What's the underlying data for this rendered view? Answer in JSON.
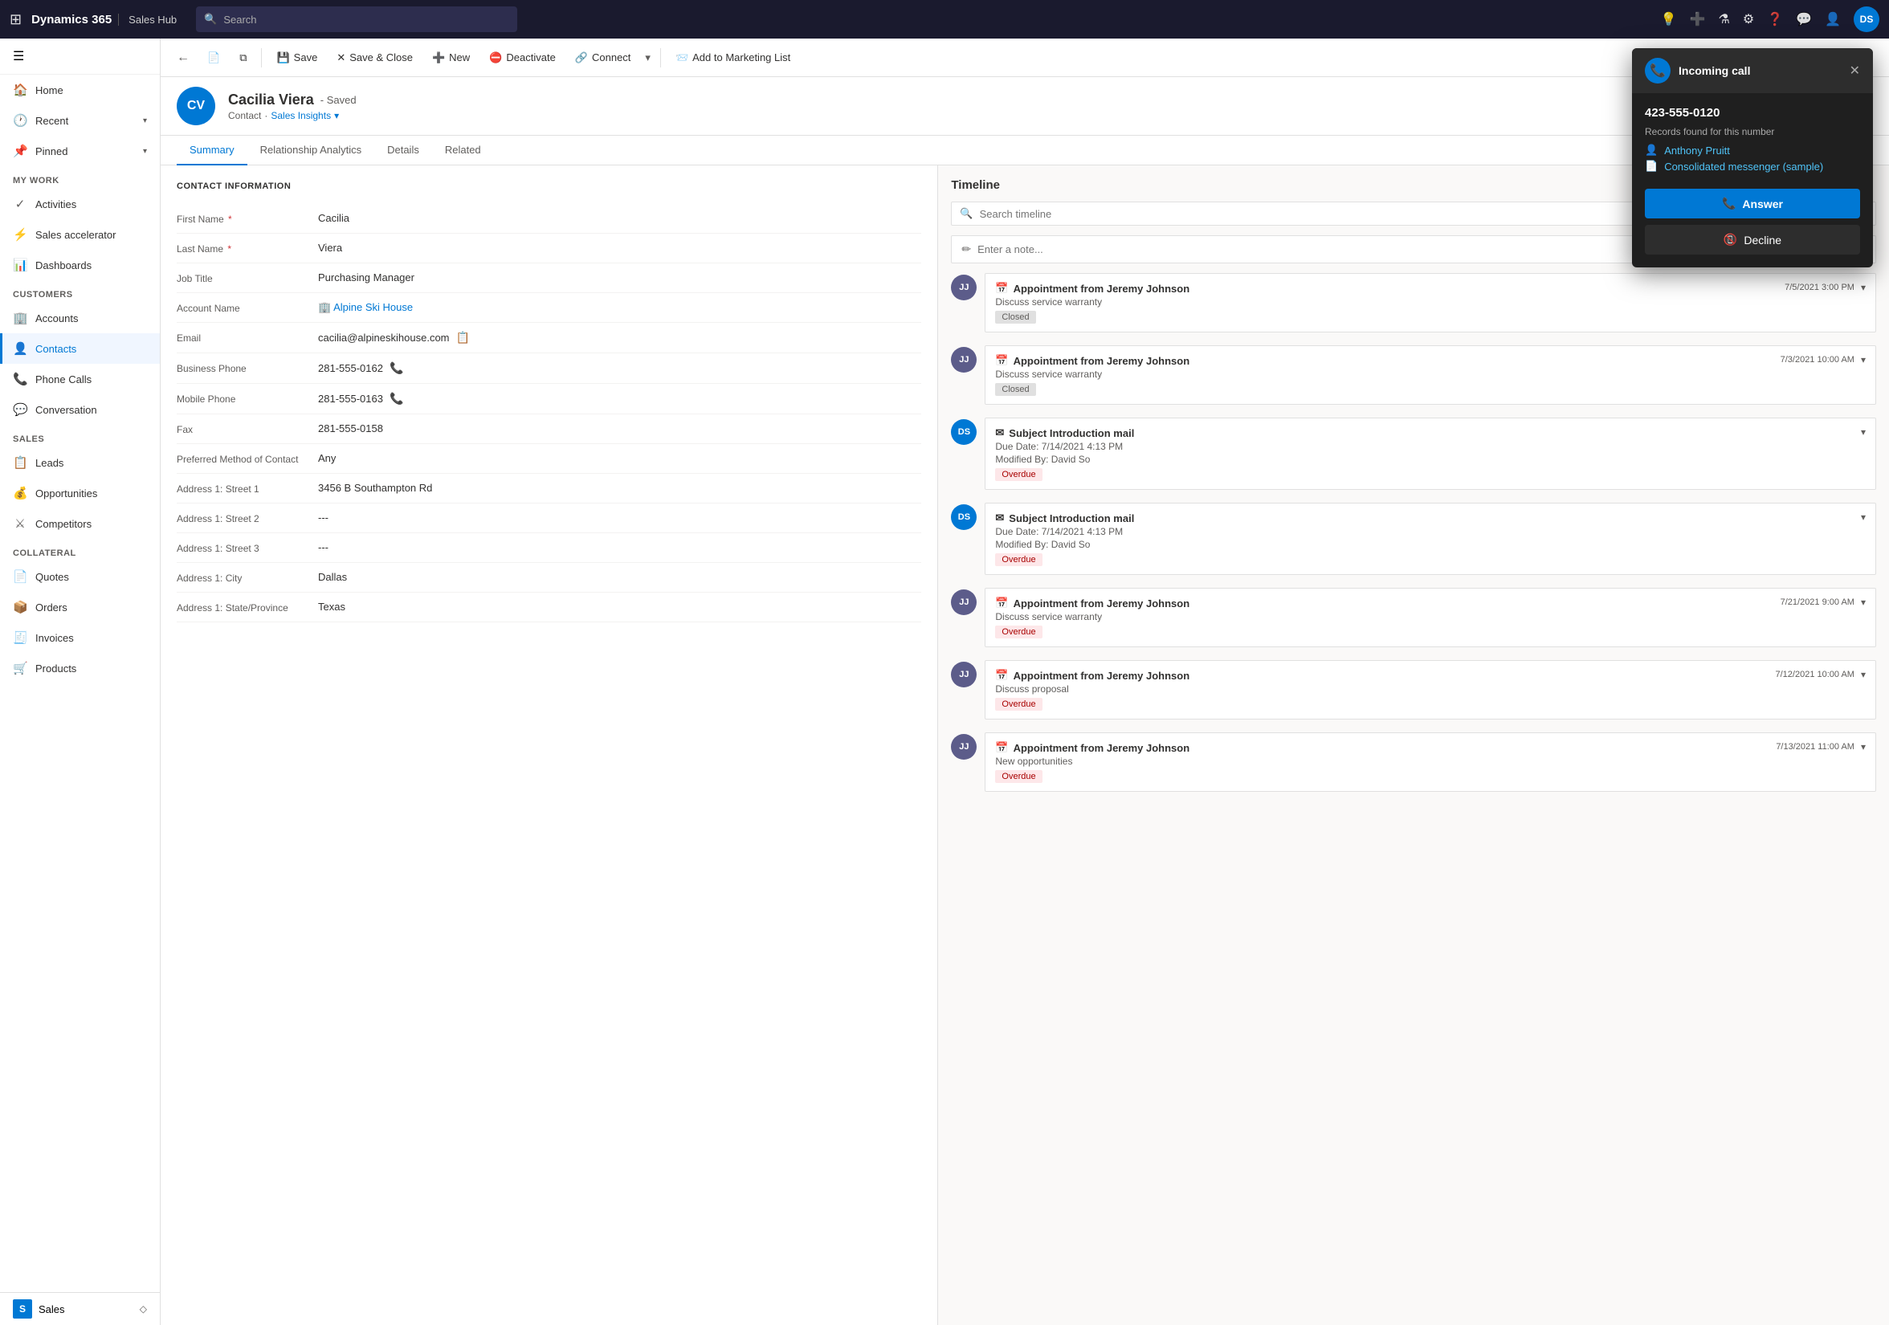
{
  "app": {
    "brand": "Dynamics 365",
    "module": "Sales Hub",
    "search_placeholder": "Search",
    "user_initials": "DS"
  },
  "toolbar": {
    "back_label": "←",
    "save_label": "Save",
    "save_close_label": "Save & Close",
    "new_label": "New",
    "deactivate_label": "Deactivate",
    "connect_label": "Connect",
    "add_marketing_label": "Add to Marketing List"
  },
  "sidebar": {
    "sections": [
      {
        "label": "",
        "items": [
          {
            "id": "home",
            "label": "Home",
            "icon": "🏠",
            "active": false
          },
          {
            "id": "recent",
            "label": "Recent",
            "icon": "🕐",
            "active": false,
            "hasChevron": true
          },
          {
            "id": "pinned",
            "label": "Pinned",
            "icon": "📌",
            "active": false,
            "hasChevron": true
          }
        ]
      },
      {
        "label": "My Work",
        "items": [
          {
            "id": "activities",
            "label": "Activities",
            "icon": "✓",
            "active": false
          },
          {
            "id": "sales-accelerator",
            "label": "Sales accelerator",
            "icon": "⚡",
            "active": false
          },
          {
            "id": "dashboards",
            "label": "Dashboards",
            "icon": "📊",
            "active": false
          }
        ]
      },
      {
        "label": "Customers",
        "items": [
          {
            "id": "accounts",
            "label": "Accounts",
            "icon": "🏢",
            "active": false
          },
          {
            "id": "contacts",
            "label": "Contacts",
            "icon": "👤",
            "active": true
          },
          {
            "id": "phone-calls",
            "label": "Phone Calls",
            "icon": "📞",
            "active": false
          },
          {
            "id": "conversation",
            "label": "Conversation",
            "icon": "💬",
            "active": false
          }
        ]
      },
      {
        "label": "Sales",
        "items": [
          {
            "id": "leads",
            "label": "Leads",
            "icon": "📋",
            "active": false
          },
          {
            "id": "opportunities",
            "label": "Opportunities",
            "icon": "💰",
            "active": false
          },
          {
            "id": "competitors",
            "label": "Competitors",
            "icon": "⚔",
            "active": false
          }
        ]
      },
      {
        "label": "Collateral",
        "items": [
          {
            "id": "quotes",
            "label": "Quotes",
            "icon": "📄",
            "active": false
          },
          {
            "id": "orders",
            "label": "Orders",
            "icon": "📦",
            "active": false
          },
          {
            "id": "invoices",
            "label": "Invoices",
            "icon": "🧾",
            "active": false
          },
          {
            "id": "products",
            "label": "Products",
            "icon": "🛒",
            "active": false
          }
        ]
      },
      {
        "label": "",
        "items": [
          {
            "id": "sales-bottom",
            "label": "Sales",
            "icon": "S",
            "active": false,
            "isBottom": true
          }
        ]
      }
    ]
  },
  "record": {
    "initials": "CV",
    "name": "Cacilia Viera",
    "saved_status": "- Saved",
    "type": "Contact",
    "enriched_label": "Sales Insights",
    "tabs": [
      "Summary",
      "Relationship Analytics",
      "Details",
      "Related"
    ],
    "active_tab": "Summary"
  },
  "contact_info": {
    "section_title": "CONTACT INFORMATION",
    "fields": [
      {
        "label": "First Name",
        "value": "Cacilia",
        "required": true
      },
      {
        "label": "Last Name",
        "value": "Viera",
        "required": true
      },
      {
        "label": "Job Title",
        "value": "Purchasing Manager",
        "required": false
      },
      {
        "label": "Account Name",
        "value": "Alpine Ski House",
        "is_link": true,
        "required": false
      },
      {
        "label": "Email",
        "value": "cacilia@alpineskihouse.com",
        "has_icon": true,
        "required": false
      },
      {
        "label": "Business Phone",
        "value": "281-555-0162",
        "has_phone_icon": true,
        "required": false
      },
      {
        "label": "Mobile Phone",
        "value": "281-555-0163",
        "has_phone_icon": true,
        "required": false
      },
      {
        "label": "Fax",
        "value": "281-555-0158",
        "required": false
      },
      {
        "label": "Preferred Method of Contact",
        "value": "Any",
        "required": false
      },
      {
        "label": "Address 1: Street 1",
        "value": "3456 B Southampton Rd",
        "required": false
      },
      {
        "label": "Address 1: Street 2",
        "value": "---",
        "required": false
      },
      {
        "label": "Address 1: Street 3",
        "value": "---",
        "required": false
      },
      {
        "label": "Address 1: City",
        "value": "Dallas",
        "required": false
      },
      {
        "label": "Address 1: State/Province",
        "value": "Texas",
        "required": false
      }
    ]
  },
  "timeline": {
    "title": "Timeline",
    "search_placeholder": "Search timeline",
    "note_placeholder": "Enter a note...",
    "items": [
      {
        "id": "jj1",
        "avatar_text": "JJ",
        "avatar_color": "#5c5c8a",
        "icon": "📅",
        "title": "Appointment from Jeremy Johnson",
        "subtitle": "Discuss service warranty",
        "status": "Closed",
        "status_type": "closed",
        "date": "7/5/2021 3:00 PM",
        "has_chevron": true
      },
      {
        "id": "jj2",
        "avatar_text": "JJ",
        "avatar_color": "#5c5c8a",
        "icon": "📅",
        "title": "Appointment from Jeremy Johnson",
        "subtitle": "Discuss service warranty",
        "status": "Closed",
        "status_type": "closed",
        "date": "7/3/2021 10:00 AM",
        "has_chevron": true
      },
      {
        "id": "ds1",
        "avatar_text": "DS",
        "avatar_color": "#0078d4",
        "icon": "✉",
        "title": "Subject Introduction mail",
        "subtitle": "Due Date: 7/14/2021 4:13 PM",
        "extra_line": "Modified By: David So",
        "status": "Overdue",
        "status_type": "overdue",
        "date": null,
        "has_chevron": true
      },
      {
        "id": "ds2",
        "avatar_text": "DS",
        "avatar_color": "#0078d4",
        "icon": "✉",
        "title": "Subject Introduction mail",
        "subtitle": "Due Date: 7/14/2021 4:13 PM",
        "extra_line": "Modified By: David So",
        "status": "Overdue",
        "status_type": "overdue",
        "date": null,
        "has_chevron": true
      },
      {
        "id": "jj3",
        "avatar_text": "JJ",
        "avatar_color": "#5c5c8a",
        "icon": "📅",
        "title": "Appointment from Jeremy Johnson",
        "subtitle": "Discuss service warranty",
        "status": "Overdue",
        "status_type": "overdue",
        "date": "7/21/2021 9:00 AM",
        "has_chevron": true
      },
      {
        "id": "jj4",
        "avatar_text": "JJ",
        "avatar_color": "#5c5c8a",
        "icon": "📅",
        "title": "Appointment from Jeremy Johnson",
        "subtitle": "Discuss proposal",
        "status": "Overdue",
        "status_type": "overdue",
        "date": "7/12/2021 10:00 AM",
        "has_chevron": true
      },
      {
        "id": "jj5",
        "avatar_text": "JJ",
        "avatar_color": "#5c5c8a",
        "icon": "📅",
        "title": "Appointment from Jeremy Johnson",
        "subtitle": "New opportunities",
        "status": "Overdue",
        "status_type": "overdue",
        "date": "7/13/2021 11:00 AM",
        "has_chevron": true
      }
    ]
  },
  "incoming_call": {
    "title": "Incoming call",
    "phone": "423-555-0120",
    "records_label": "Records found for this number",
    "records": [
      {
        "id": "r1",
        "icon": "👤",
        "label": "Anthony Pruitt"
      },
      {
        "id": "r2",
        "icon": "📄",
        "label": "Consolidated messenger (sample)"
      }
    ],
    "answer_label": "Answer",
    "decline_label": "Decline"
  }
}
